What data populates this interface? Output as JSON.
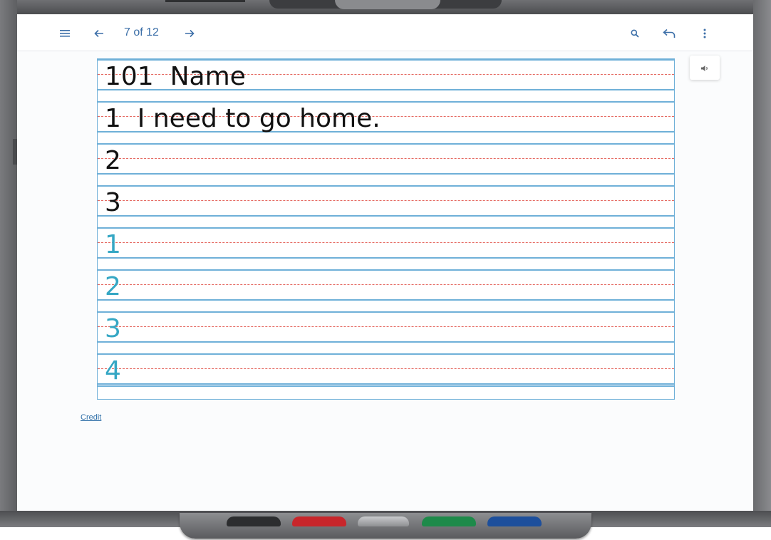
{
  "toolbar": {
    "menu_icon": "menu-icon",
    "prev_icon": "arrow-left-icon",
    "page_indicator": "7 of 12",
    "next_icon": "arrow-right-icon",
    "search_icon": "search-icon",
    "reply_icon": "reply-icon",
    "more_icon": "more-vertical-icon"
  },
  "audio": {
    "icon": "speaker-icon"
  },
  "worksheet": {
    "rows": [
      {
        "text": "101  Name",
        "color": "#111111"
      },
      {
        "text": "1  I need to go home.",
        "color": "#111111"
      },
      {
        "text": "2",
        "color": "#111111"
      },
      {
        "text": "3",
        "color": "#111111"
      },
      {
        "text": "1",
        "color": "#35a7c4"
      },
      {
        "text": "2",
        "color": "#35a7c4"
      },
      {
        "text": "3",
        "color": "#35a7c4"
      },
      {
        "text": "4",
        "color": "#35a7c4"
      }
    ]
  },
  "footer": {
    "credit_link": "Credit"
  },
  "colors": {
    "accent": "#3c6fa8",
    "rule_blue": "#6fb0d8",
    "rule_red_dashed": "#e56a62",
    "marker_black": "#2c2d2f",
    "marker_red": "#c8262b",
    "marker_green": "#1e8a4a",
    "marker_blue": "#1d4f9c"
  }
}
